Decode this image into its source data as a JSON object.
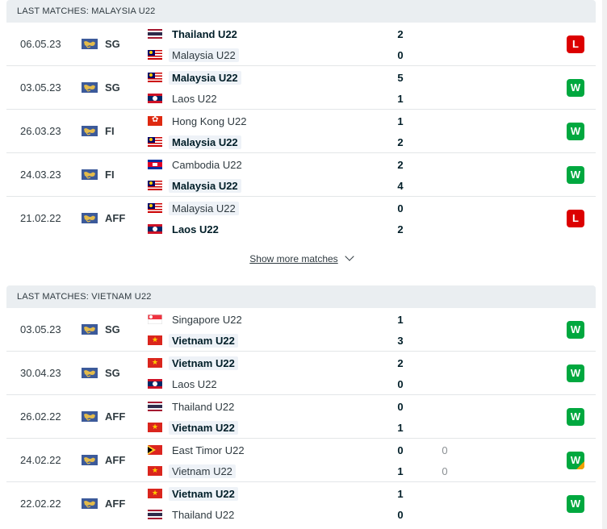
{
  "sections": [
    {
      "title": "LAST MATCHES: MALAYSIA U22",
      "matches": [
        {
          "date": "06.05.23",
          "league": "SG",
          "home": {
            "name": "Thailand U22",
            "flag": "th",
            "bold": true,
            "highlight": false
          },
          "away": {
            "name": "Malaysia U22",
            "flag": "my",
            "bold": false,
            "highlight": true
          },
          "home_score": "2",
          "away_score": "0",
          "result": "L"
        },
        {
          "date": "03.05.23",
          "league": "SG",
          "home": {
            "name": "Malaysia U22",
            "flag": "my",
            "bold": true,
            "highlight": true
          },
          "away": {
            "name": "Laos U22",
            "flag": "la",
            "bold": false,
            "highlight": false
          },
          "home_score": "5",
          "away_score": "1",
          "result": "W"
        },
        {
          "date": "26.03.23",
          "league": "FI",
          "home": {
            "name": "Hong Kong U22",
            "flag": "hk",
            "bold": false,
            "highlight": false
          },
          "away": {
            "name": "Malaysia U22",
            "flag": "my",
            "bold": true,
            "highlight": true
          },
          "home_score": "1",
          "away_score": "2",
          "result": "W"
        },
        {
          "date": "24.03.23",
          "league": "FI",
          "home": {
            "name": "Cambodia U22",
            "flag": "kh",
            "bold": false,
            "highlight": false
          },
          "away": {
            "name": "Malaysia U22",
            "flag": "my",
            "bold": true,
            "highlight": true
          },
          "home_score": "2",
          "away_score": "4",
          "result": "W"
        },
        {
          "date": "21.02.22",
          "league": "AFF",
          "home": {
            "name": "Malaysia U22",
            "flag": "my",
            "bold": false,
            "highlight": true
          },
          "away": {
            "name": "Laos U22",
            "flag": "la",
            "bold": true,
            "highlight": false
          },
          "home_score": "0",
          "away_score": "2",
          "result": "L"
        }
      ]
    },
    {
      "title": "LAST MATCHES: VIETNAM U22",
      "matches": [
        {
          "date": "03.05.23",
          "league": "SG",
          "home": {
            "name": "Singapore U22",
            "flag": "sg",
            "bold": false,
            "highlight": false
          },
          "away": {
            "name": "Vietnam U22",
            "flag": "vn",
            "bold": true,
            "highlight": true
          },
          "home_score": "1",
          "away_score": "3",
          "result": "W"
        },
        {
          "date": "30.04.23",
          "league": "SG",
          "home": {
            "name": "Vietnam U22",
            "flag": "vn",
            "bold": true,
            "highlight": true
          },
          "away": {
            "name": "Laos U22",
            "flag": "la",
            "bold": false,
            "highlight": false
          },
          "home_score": "2",
          "away_score": "0",
          "result": "W"
        },
        {
          "date": "26.02.22",
          "league": "AFF",
          "home": {
            "name": "Thailand U22",
            "flag": "th",
            "bold": false,
            "highlight": false
          },
          "away": {
            "name": "Vietnam U22",
            "flag": "vn",
            "bold": true,
            "highlight": true
          },
          "home_score": "0",
          "away_score": "1",
          "result": "W"
        },
        {
          "date": "24.02.22",
          "league": "AFF",
          "home": {
            "name": "East Timor U22",
            "flag": "tl",
            "bold": false,
            "highlight": false
          },
          "away": {
            "name": "Vietnam U22",
            "flag": "vn",
            "bold": false,
            "highlight": true
          },
          "home_score": "0",
          "away_score": "1",
          "home_pen": "0",
          "away_pen": "0",
          "result": "W",
          "result_note": "penalty-win-corner"
        },
        {
          "date": "22.02.22",
          "league": "AFF",
          "home": {
            "name": "Vietnam U22",
            "flag": "vn",
            "bold": true,
            "highlight": true
          },
          "away": {
            "name": "Thailand U22",
            "flag": "th",
            "bold": false,
            "highlight": false
          },
          "home_score": "1",
          "away_score": "0",
          "result": "W"
        }
      ]
    }
  ],
  "show_more_label": "Show more matches",
  "icons": {
    "league": "world-flag-icon",
    "show_more": "chevron-down-icon"
  },
  "colors": {
    "win": "#00a83f",
    "loss": "#dc0000",
    "header_bg": "#eaeef1",
    "highlight_bg": "#eef2f7",
    "penalty_corner": "#f3a000"
  }
}
